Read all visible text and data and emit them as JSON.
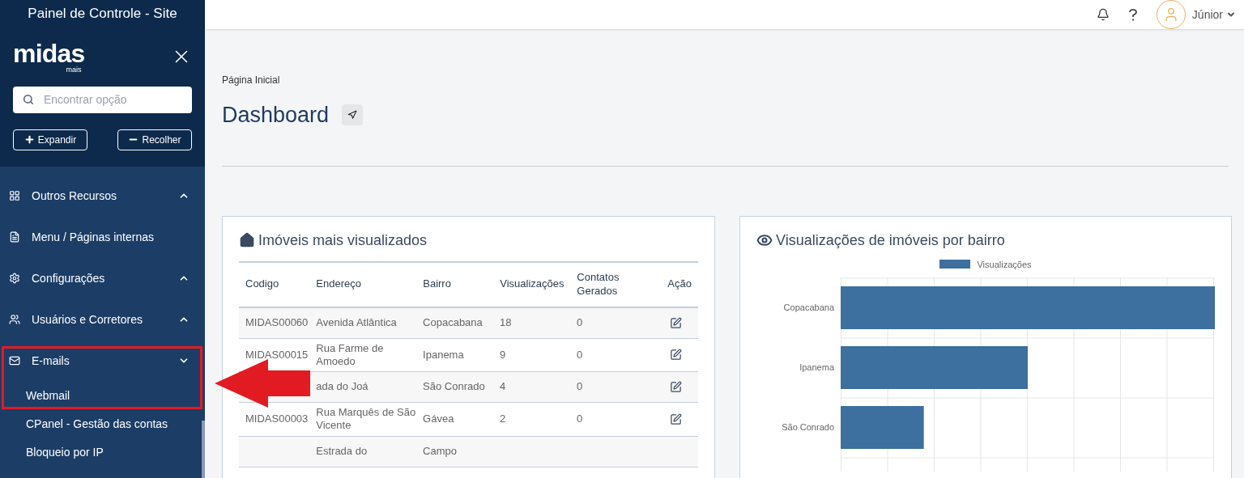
{
  "sidebar": {
    "title": "Painel de Controle - Site",
    "logo": {
      "name": "midas",
      "tagline": "mais"
    },
    "search": {
      "placeholder": "Encontrar opção"
    },
    "buttons": [
      {
        "kind": "expand",
        "label": "Expandir"
      },
      {
        "kind": "collapse",
        "label": "Recolher"
      }
    ],
    "items": [
      {
        "kind": "grid",
        "label": "Outros Recursos",
        "expanded": false
      },
      {
        "kind": "page",
        "label": "Menu / Páginas internas"
      },
      {
        "kind": "gear",
        "label": "Configurações",
        "expanded": false
      },
      {
        "kind": "users",
        "label": "Usuários e Corretores",
        "expanded": false
      },
      {
        "kind": "mail",
        "label": "E-mails",
        "expanded": true,
        "children": [
          {
            "label": "Webmail"
          },
          {
            "label": "CPanel - Gestão das contas"
          },
          {
            "label": "Bloqueio por IP"
          }
        ]
      }
    ]
  },
  "header": {
    "user": "Júnior"
  },
  "breadcrumb": "Página Inicial",
  "title": "Dashboard",
  "table_card": {
    "title": "Imóveis mais visualizados",
    "columns": [
      "Codigo",
      "Endereço",
      "Bairro",
      "Visualizações",
      "Contatos Gerados",
      "Ação"
    ],
    "rows": [
      {
        "code": "MIDAS00060",
        "address": "Avenida Atlântica",
        "district": "Copacabana",
        "views": "18",
        "contacts": "0"
      },
      {
        "code": "MIDAS00015",
        "address": "Rua Farme de Amoedo",
        "district": "Ipanema",
        "views": "9",
        "contacts": "0"
      },
      {
        "address": "ada do Joá",
        "district": "São Conrado",
        "views": "4",
        "contacts": "0"
      },
      {
        "code": "MIDAS00003",
        "address": "Rua Marquês de São Vicente",
        "district": "Gávea",
        "views": "2",
        "contacts": "0"
      },
      {
        "address": "Estrada do",
        "district": "Campo"
      }
    ]
  },
  "chart_card": {
    "title": "Visualizações de imóveis por bairro",
    "legend": "Visualizações",
    "categories": [
      "Copacabana",
      "Ipanema",
      "São Conrado"
    ]
  }
}
